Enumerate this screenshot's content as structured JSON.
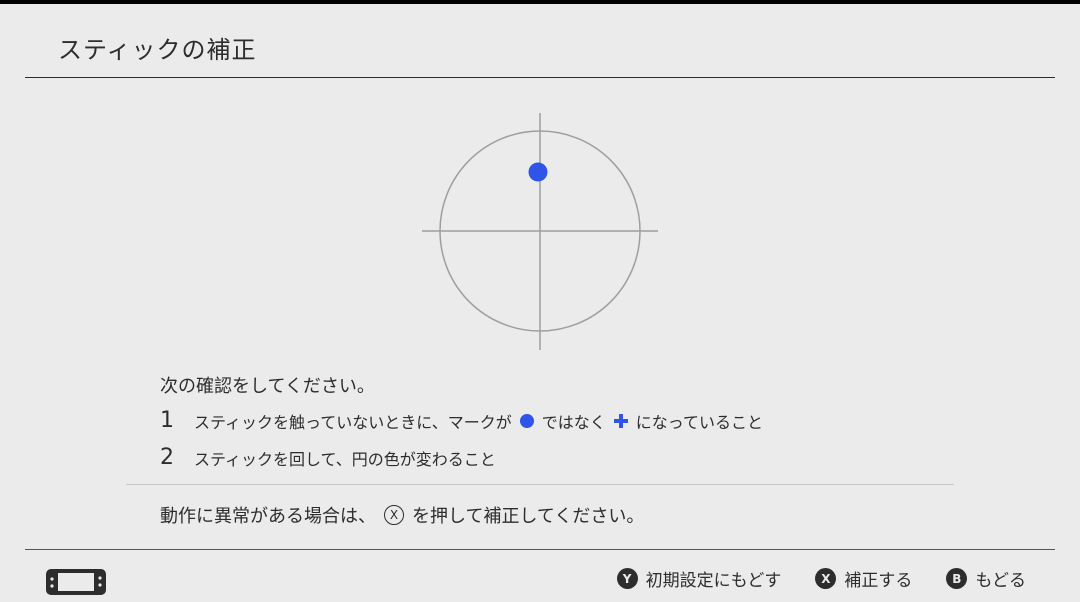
{
  "header": {
    "title": "スティックの補正"
  },
  "stick_display": {
    "circle_color": "#9e9e9e",
    "cross_color": "#9e9e9e",
    "marker_color": "#2f55e8",
    "marker_shape": "dot"
  },
  "instructions": {
    "heading": "次の確認をしてください。",
    "steps": [
      {
        "number": "1",
        "text_before": "スティックを触っていないときに、マークが",
        "middle": "ではなく",
        "text_after": "になっていること"
      },
      {
        "number": "2",
        "text": "スティックを回して、円の色が変わること"
      }
    ]
  },
  "notice": {
    "text_before": "動作に異常がある場合は、",
    "button": "X",
    "text_after": "を押して補正してください。"
  },
  "footer": {
    "console_icon": "handheld-console-icon",
    "actions": [
      {
        "button": "Y",
        "label": "初期設定にもどす"
      },
      {
        "button": "X",
        "label": "補正する"
      },
      {
        "button": "B",
        "label": "もどる"
      }
    ]
  }
}
